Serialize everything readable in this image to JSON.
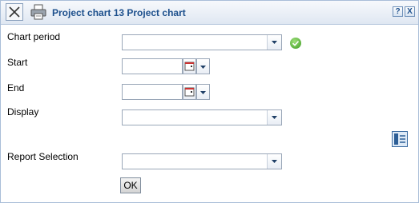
{
  "window": {
    "title": "Project chart 13 Project chart",
    "help_label": "?",
    "close_label": "X"
  },
  "icons": {
    "close": "close-icon",
    "print": "printer-icon",
    "valid": "check-circle-icon",
    "report": "report-icon",
    "calendar": "calendar-icon",
    "dropdown": "chevron-down-icon"
  },
  "form": {
    "chart_period": {
      "label": "Chart period",
      "value": ""
    },
    "start": {
      "label": "Start",
      "value": ""
    },
    "end": {
      "label": "End",
      "value": ""
    },
    "display": {
      "label": "Display",
      "value": ""
    },
    "report_selection": {
      "label": "Report Selection",
      "value": ""
    }
  },
  "actions": {
    "ok_label": "OK"
  },
  "colors": {
    "title_text": "#1c4f8c",
    "border": "#9aa7b8",
    "valid_green": "#3d9b23"
  }
}
